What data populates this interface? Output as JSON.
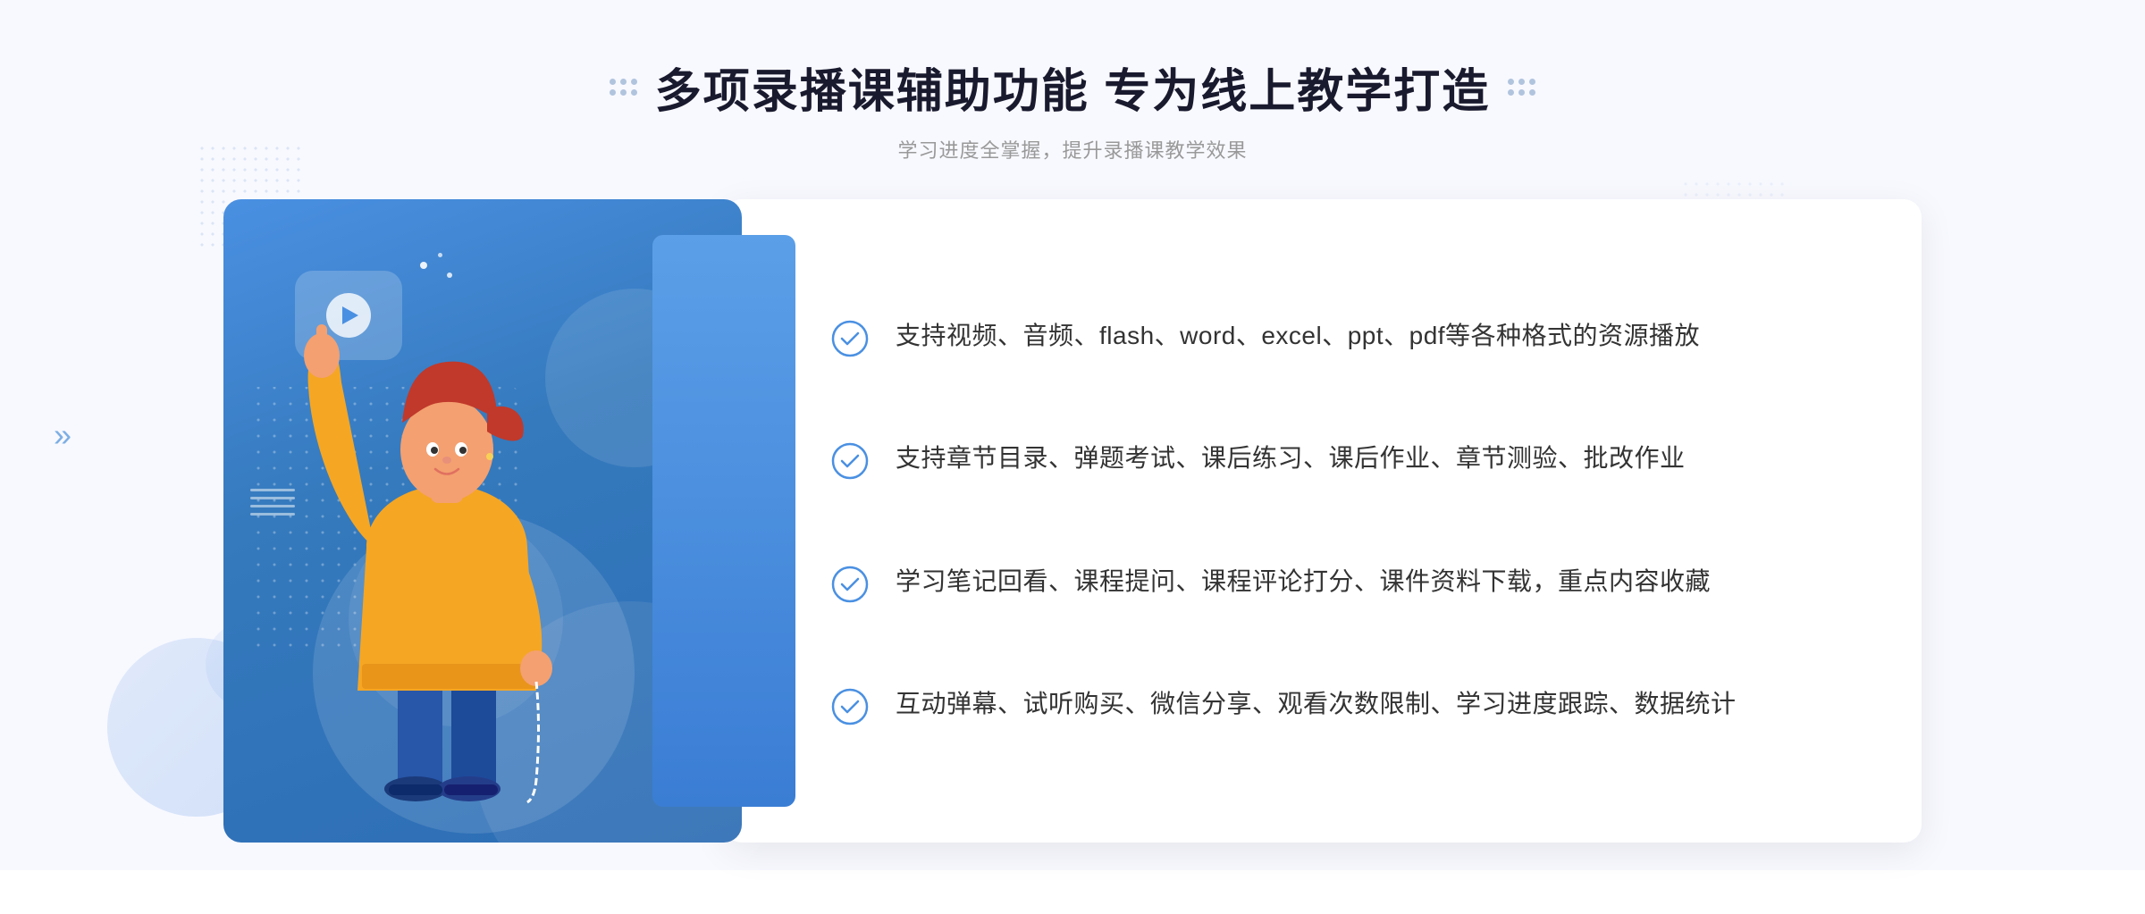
{
  "page": {
    "background": "#f0f4fc"
  },
  "header": {
    "main_title": "多项录播课辅助功能 专为线上教学打造",
    "sub_title": "学习进度全掌握，提升录播课教学效果"
  },
  "features": [
    {
      "id": 1,
      "text": "支持视频、音频、flash、word、excel、ppt、pdf等各种格式的资源播放"
    },
    {
      "id": 2,
      "text": "支持章节目录、弹题考试、课后练习、课后作业、章节测验、批改作业"
    },
    {
      "id": 3,
      "text": "学习笔记回看、课程提问、课程评论打分、课件资料下载，重点内容收藏"
    },
    {
      "id": 4,
      "text": "互动弹幕、试听购买、微信分享、观看次数限制、学习进度跟踪、数据统计"
    }
  ],
  "icons": {
    "check_circle": "✓",
    "play": "▶",
    "chevron_left": "«",
    "chevron_right": "»"
  },
  "colors": {
    "primary_blue": "#4a90e2",
    "dark_blue": "#2d6db5",
    "light_blue": "#e8f0fc",
    "text_dark": "#333333",
    "text_gray": "#999999",
    "white": "#ffffff"
  }
}
